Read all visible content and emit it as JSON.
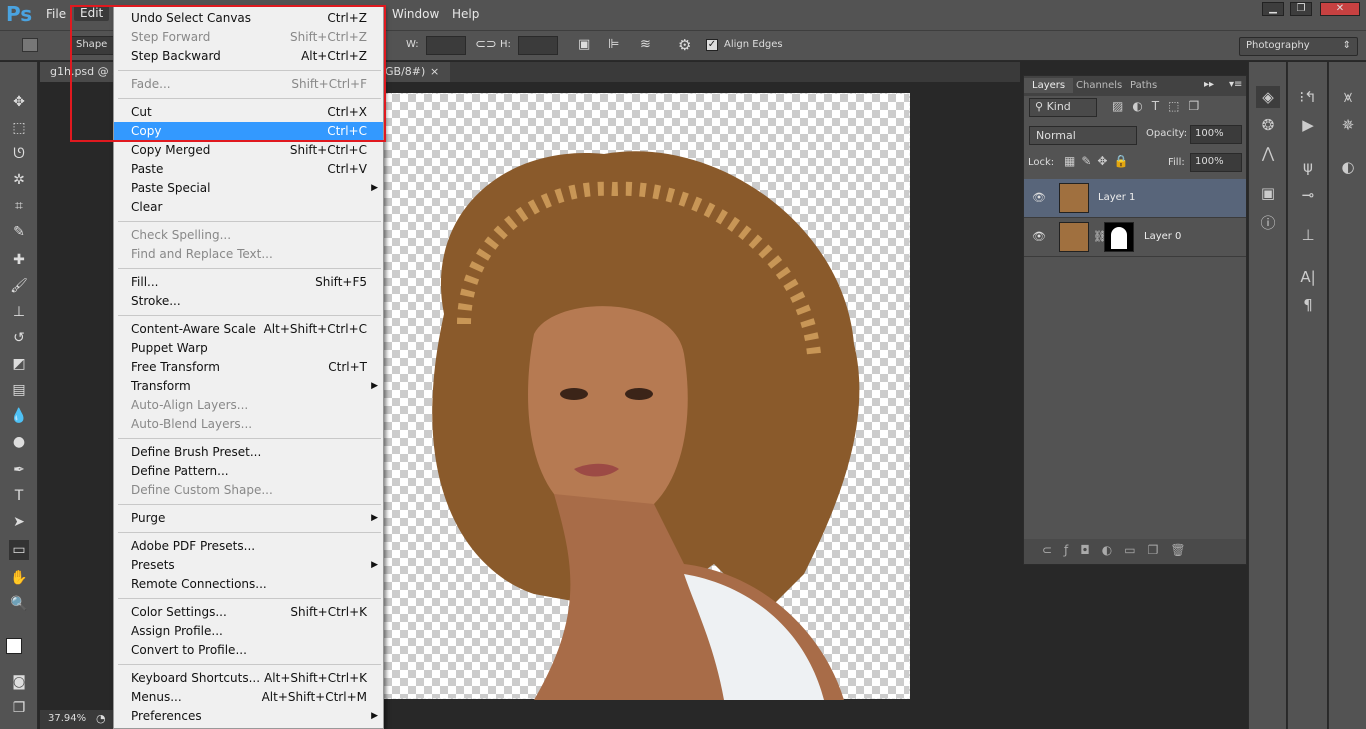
{
  "app": {
    "logo": "Ps"
  },
  "menubar": {
    "items": [
      "File",
      "Edit",
      "Window",
      "Help"
    ]
  },
  "options": {
    "shape_mode": "Shape",
    "w_label": "W:",
    "h_label": "H:",
    "align_edges": "Align Edges",
    "align_checked": true,
    "workspace": "Photography"
  },
  "document": {
    "tab": "g1h.psd @ 3",
    "tab_suffix": "GB/8#)",
    "zoom": "37.94%"
  },
  "edit_menu": [
    {
      "label": "Undo Select Canvas",
      "shortcut": "Ctrl+Z"
    },
    {
      "label": "Step Forward",
      "shortcut": "Shift+Ctrl+Z",
      "disabled": true
    },
    {
      "label": "Step Backward",
      "shortcut": "Alt+Ctrl+Z"
    },
    {
      "sep": true
    },
    {
      "label": "Fade...",
      "shortcut": "Shift+Ctrl+F",
      "disabled": true
    },
    {
      "sep": true
    },
    {
      "label": "Cut",
      "shortcut": "Ctrl+X"
    },
    {
      "label": "Copy",
      "shortcut": "Ctrl+C",
      "selected": true
    },
    {
      "label": "Copy Merged",
      "shortcut": "Shift+Ctrl+C"
    },
    {
      "label": "Paste",
      "shortcut": "Ctrl+V"
    },
    {
      "label": "Paste Special",
      "submenu": true
    },
    {
      "label": "Clear"
    },
    {
      "sep": true
    },
    {
      "label": "Check Spelling...",
      "disabled": true
    },
    {
      "label": "Find and Replace Text...",
      "disabled": true
    },
    {
      "sep": true
    },
    {
      "label": "Fill...",
      "shortcut": "Shift+F5"
    },
    {
      "label": "Stroke..."
    },
    {
      "sep": true
    },
    {
      "label": "Content-Aware Scale",
      "shortcut": "Alt+Shift+Ctrl+C"
    },
    {
      "label": "Puppet Warp"
    },
    {
      "label": "Free Transform",
      "shortcut": "Ctrl+T"
    },
    {
      "label": "Transform",
      "submenu": true
    },
    {
      "label": "Auto-Align Layers...",
      "disabled": true
    },
    {
      "label": "Auto-Blend Layers...",
      "disabled": true
    },
    {
      "sep": true
    },
    {
      "label": "Define Brush Preset..."
    },
    {
      "label": "Define Pattern..."
    },
    {
      "label": "Define Custom Shape...",
      "disabled": true
    },
    {
      "sep": true
    },
    {
      "label": "Purge",
      "submenu": true
    },
    {
      "sep": true
    },
    {
      "label": "Adobe PDF Presets..."
    },
    {
      "label": "Presets",
      "submenu": true
    },
    {
      "label": "Remote Connections..."
    },
    {
      "sep": true
    },
    {
      "label": "Color Settings...",
      "shortcut": "Shift+Ctrl+K"
    },
    {
      "label": "Assign Profile..."
    },
    {
      "label": "Convert to Profile..."
    },
    {
      "sep": true
    },
    {
      "label": "Keyboard Shortcuts...",
      "shortcut": "Alt+Shift+Ctrl+K"
    },
    {
      "label": "Menus...",
      "shortcut": "Alt+Shift+Ctrl+M"
    },
    {
      "label": "Preferences",
      "submenu": true
    }
  ],
  "layers_panel": {
    "tabs": [
      "Layers",
      "Channels",
      "Paths"
    ],
    "filter": "Kind",
    "blend_mode": "Normal",
    "opacity_label": "Opacity:",
    "opacity": "100%",
    "lock_label": "Lock:",
    "fill_label": "Fill:",
    "fill": "100%",
    "layers": [
      {
        "name": "Layer 1",
        "selected": true
      },
      {
        "name": "Layer 0",
        "mask": true
      }
    ]
  },
  "colors": {
    "accent": "#3399ff",
    "highlight_box": "#e0191f",
    "selected_layer": "#58657a"
  }
}
